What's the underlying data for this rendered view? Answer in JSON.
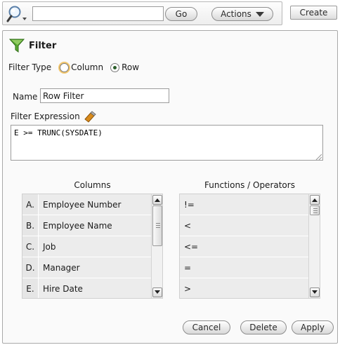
{
  "toolbar": {
    "search_value": "",
    "go_label": "Go",
    "actions_label": "Actions",
    "create_label": "Create"
  },
  "dialog": {
    "title": "Filter",
    "filter_type_label": "Filter Type",
    "filter_type_options": [
      "Column",
      "Row"
    ],
    "filter_type_selected": "Row",
    "name_label": "Name",
    "name_value": "Row Filter",
    "expression_label": "Filter Expression",
    "expression_value": "E >= TRUNC(SYSDATE)"
  },
  "columns": {
    "header": "Columns",
    "items": [
      {
        "letter": "A.",
        "name": "Employee Number"
      },
      {
        "letter": "B.",
        "name": "Employee Name"
      },
      {
        "letter": "C.",
        "name": "Job"
      },
      {
        "letter": "D.",
        "name": "Manager"
      },
      {
        "letter": "E.",
        "name": "Hire Date"
      }
    ]
  },
  "functions": {
    "header": "Functions / Operators",
    "items": [
      "!=",
      "<",
      "<=",
      "=",
      ">"
    ]
  },
  "footer": {
    "cancel_label": "Cancel",
    "delete_label": "Delete",
    "apply_label": "Apply"
  },
  "colors": {
    "funnel": "#4e9a2a",
    "radio_focus": "#f3c76d",
    "panel_bg": "#efefef"
  }
}
